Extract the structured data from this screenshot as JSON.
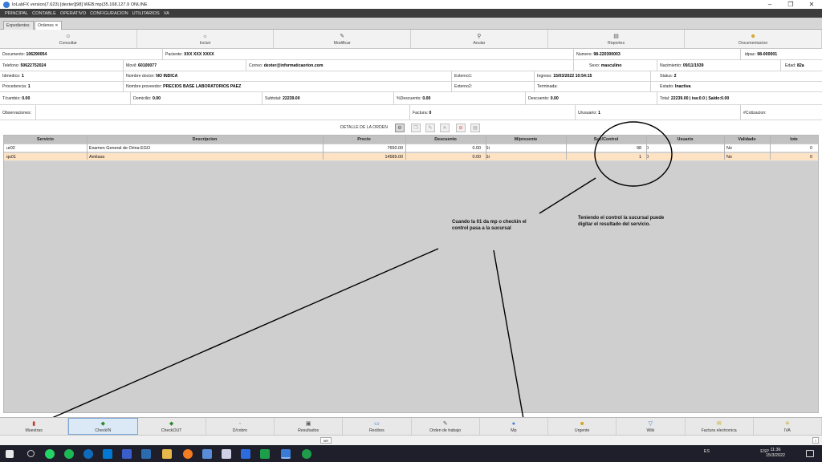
{
  "window": {
    "title": "IoLabFX version(7.623)  [dexter][98] WEB:mp(35.168.127.9 ONLINE",
    "controls": [
      "–",
      "❐",
      "✕"
    ]
  },
  "menu": [
    "PRINCIPAL",
    "CONTABLE",
    "OPERATIVO",
    "CONFIGURACION",
    "UTILITARIOS",
    "VA"
  ],
  "tabs": [
    {
      "label": "Expedientes"
    },
    {
      "label": "Ordenes ✕"
    }
  ],
  "actions": [
    {
      "label": "Consultar",
      "icon": "person-icon",
      "glyph": "☺"
    },
    {
      "label": "Incluir",
      "icon": "sun-icon",
      "glyph": "☼"
    },
    {
      "label": "Modificar",
      "icon": "edit-icon",
      "glyph": "✎"
    },
    {
      "label": "Anular",
      "icon": "cancel-icon",
      "glyph": "⚲"
    },
    {
      "label": "Reportes",
      "icon": "printer-icon",
      "glyph": "▤"
    },
    {
      "label": "Documentacion",
      "icon": "smiley-icon",
      "glyph": "☻"
    }
  ],
  "form": {
    "documento_label": "Documento:",
    "documento": "106290054",
    "paciente_label": "Paciente:",
    "paciente": "XXX XXX XXXX",
    "numero_label": "Numero:",
    "numero": "98-220300003",
    "idpac_label": "idpac:",
    "idpac": "98-000001",
    "telefono_label": "Telefono:",
    "telefono": "50622752024",
    "movil_label": "Movil:",
    "movil": "60100077",
    "correo_label": "Correo:",
    "correo": "dexter@informaticaorion.com",
    "sexo_label": "Sexo:",
    "sexo": "masculino",
    "nacimiento_label": "Nacimiento:",
    "nacimiento": "09/11/1939",
    "edad_label": "Edad:",
    "edad": "82a",
    "idmedico_label": "Idmedico:",
    "idmedico": "1",
    "doctor_label": "Nombre doctor:",
    "doctor": "NO INDICA",
    "externo1_label": "Externo1:",
    "externo1": "",
    "ingreso_label": "Ingreso:",
    "ingreso": "15/03/2022 10:54:15",
    "status_label": "Status:",
    "status": "2",
    "procedencia_label": "Procedencia:",
    "procedencia": "1",
    "proveedor_label": "Nombre proveedor:",
    "proveedor": "PRECIOS BASE LABORATORIOS PAEZ",
    "externo2_label": "Externo2:",
    "externo2": "",
    "terminada_label": "Terminada:",
    "terminada": "",
    "estado_label": "Estado:",
    "estado": "Inactiva",
    "tcambio_label": "T/cambio:",
    "tcambio": "0.00",
    "domicilio_label": "Domicilio:",
    "domicilio": "0.00",
    "subtotal_label": "Subtotal:",
    "subtotal": "22239.00",
    "pdescuento_label": "%Descuento:",
    "pdescuento": "0.00",
    "descuento_label": "Descuento:",
    "descuento": "0.00",
    "total_label": "Total:",
    "total": "22239.00  | iva:0.0  | Saldo:0.00",
    "observaciones_label": "Observaciones:",
    "factura_label": "Factura:",
    "factura": "0",
    "uusuario_label": "U/usuario:",
    "uusuario": "1",
    "cotizacion_label": "#Cotizacion:"
  },
  "detail": {
    "label": "DETALLE DE LA ORDEN",
    "icons": [
      "tools-icon",
      "copy-icon",
      "edit-icon",
      "delete-icon",
      "stop-icon",
      "print-icon"
    ]
  },
  "grid": {
    "columns": [
      "Servicio",
      "Descripcion",
      "Precio",
      "Descuento",
      "M/presente",
      "Suc/Control",
      "Usuario",
      "Validado",
      "lote"
    ],
    "rows": [
      {
        "servicio": "ur02",
        "descripcion": "Examen General de Orina EGO",
        "precio": "7650.00",
        "descuento": "0.00",
        "mpresente": "Si",
        "control": "98",
        "usuario": "0",
        "validado": "No",
        "lote": "0"
      },
      {
        "servicio": "qu01",
        "descripcion": "Amilasa",
        "precio": "14589.00",
        "descuento": "0.00",
        "mpresente": "Si",
        "control": "1",
        "usuario": "0",
        "validado": "No",
        "lote": "0"
      }
    ]
  },
  "annotations": {
    "note1": "Cuando la 01 da mp o checkin el control pasa a la sucursal",
    "note2": "Teniendo el control la sucursal puede digitar el resultado del servicio."
  },
  "bottom_buttons": [
    {
      "label": "Muestras",
      "glyph": "▮",
      "color": "#c0392b"
    },
    {
      "label": "CheckIN",
      "glyph": "◆",
      "color": "#2a8a2a"
    },
    {
      "label": "CheckOUT",
      "glyph": "◆",
      "color": "#2a8a2a"
    },
    {
      "label": "D/cobro",
      "glyph": "▫",
      "color": "#999999"
    },
    {
      "label": "Resultados",
      "glyph": "▣",
      "color": "#555555"
    },
    {
      "label": "Recibos",
      "glyph": "▭",
      "color": "#3a7bd5"
    },
    {
      "label": "Orden de trabajo",
      "glyph": "✎",
      "color": "#555555"
    },
    {
      "label": "Mp",
      "glyph": "●",
      "color": "#3a7bd5"
    },
    {
      "label": "Urgente",
      "glyph": "☻",
      "color": "#d4a017"
    },
    {
      "label": "Wiki",
      "glyph": "▽",
      "color": "#3a7bd5"
    },
    {
      "label": "Factura electronica",
      "glyph": "✉",
      "color": "#d4a017"
    },
    {
      "label": "IVA",
      "glyph": "☀",
      "color": "#d4a017"
    }
  ],
  "status": {
    "ver": "ver",
    "info": "i"
  },
  "taskbar": {
    "lang": "ESP",
    "locale": "ES",
    "time": "11:36",
    "date": "15/3/2022",
    "apps": [
      "#e8e8e8",
      "#1a1a1a",
      "#25d366",
      "#1db954",
      "#0078d4",
      "#0f6cbd",
      "#3a5fcd",
      "#2b6cb0",
      "#e8b84a",
      "#f57c20",
      "#5a8dd8",
      "#d0d0e8",
      "#2d6cdf",
      "#1e9e4a",
      "#3a7bd5",
      "#e0e0e0"
    ]
  }
}
